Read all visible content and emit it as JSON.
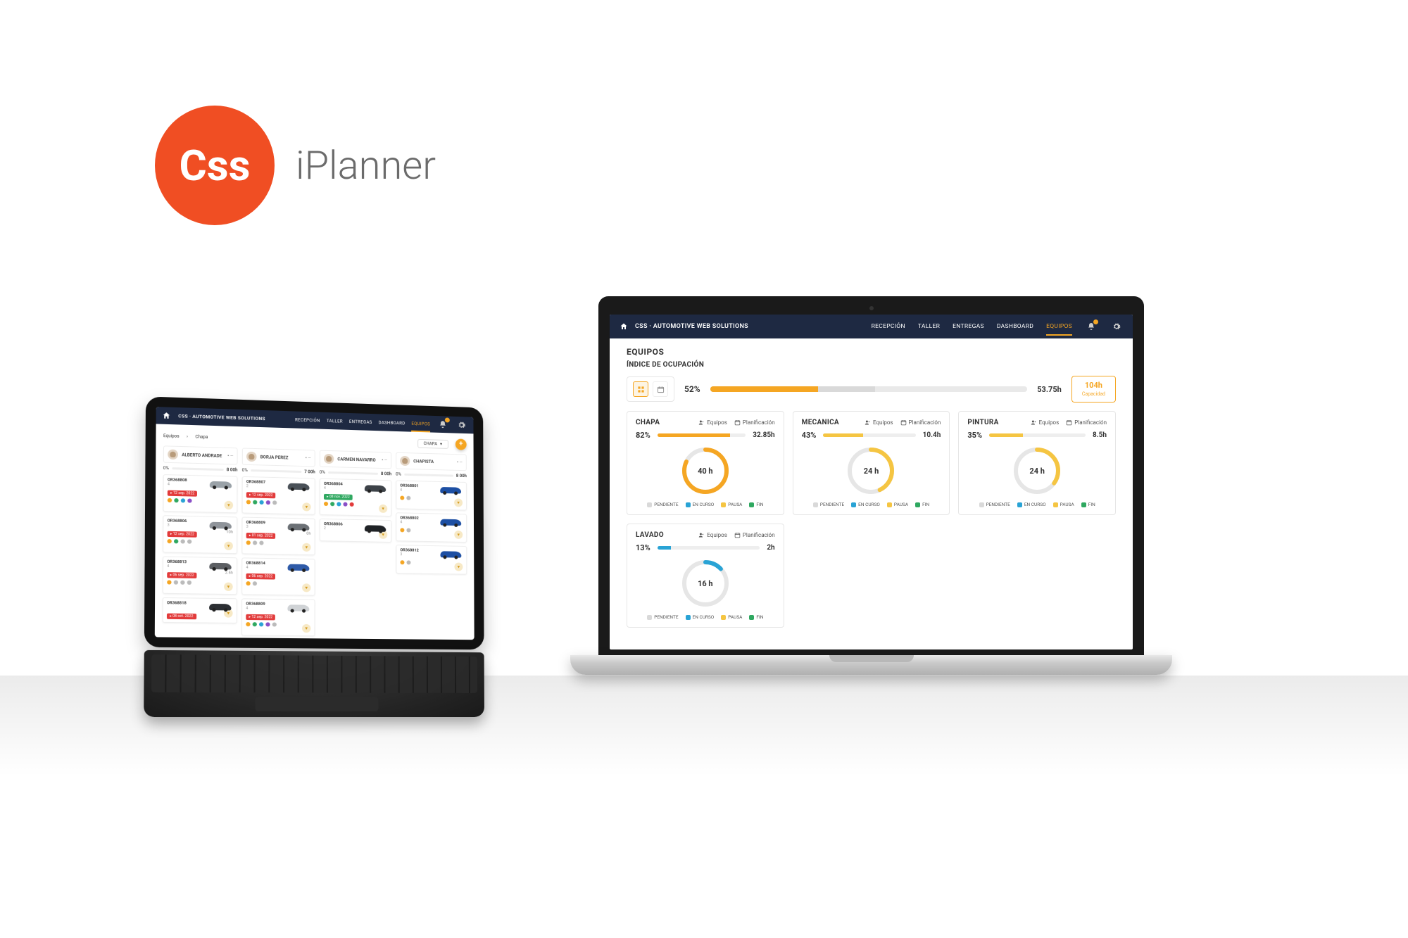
{
  "brand": {
    "circle": "Css",
    "text": "iPlanner"
  },
  "app": {
    "title": "CSS · AUTOMOTIVE WEB SOLUTIONS"
  },
  "nav": {
    "items": [
      "RECEPCIÓN",
      "TALLER",
      "ENTREGAS",
      "DASHBOARD",
      "EQUIPOS"
    ],
    "active": "EQUIPOS"
  },
  "laptop": {
    "h1": "EQUIPOS",
    "h2": "ÍNDICE DE OCUPACIÓN",
    "summary": {
      "percent": "52%",
      "hours": "53.75h",
      "capacity_value": "104h",
      "capacity_label": "Capacidad",
      "seg_orange_pct": 34,
      "seg_mid_pct": 52
    },
    "mini_links": {
      "equipos": "Equipos",
      "planificacion": "Planificación"
    },
    "legend": {
      "pendiente": "PENDIENTE",
      "encurso": "EN CURSO",
      "pausa": "PAUSA",
      "fin": "FIN"
    },
    "cards": [
      {
        "title": "CHAPA",
        "percent": "82%",
        "hours": "32.85h",
        "bar_fill": 82,
        "bar_color": "#f5a623",
        "center": "40 h",
        "arc_color": "#f5a623",
        "arc_pct": 82
      },
      {
        "title": "MECANICA",
        "percent": "43%",
        "hours": "10.4h",
        "bar_fill": 43,
        "bar_color": "#f5c542",
        "center": "24 h",
        "arc_color": "#f5c542",
        "arc_pct": 43
      },
      {
        "title": "PINTURA",
        "percent": "35%",
        "hours": "8.5h",
        "bar_fill": 35,
        "bar_color": "#f5c542",
        "center": "24 h",
        "arc_color": "#f5c542",
        "arc_pct": 35
      },
      {
        "title": "LAVADO",
        "percent": "13%",
        "hours": "2h",
        "bar_fill": 13,
        "bar_color": "#29a3d5",
        "center": "16 h",
        "arc_color": "#29a3d5",
        "arc_pct": 13
      }
    ]
  },
  "tablet": {
    "breadcrumb": [
      "Equipos",
      "Chapa"
    ],
    "dropdown": "CHAPA",
    "columns": [
      {
        "name": "ALBERTO ANDRADE",
        "pct": "0%",
        "hrs": "8 00h",
        "bar": 0,
        "jobs": [
          {
            "id": "OR368808",
            "sub": "4",
            "car": "#9aa2a8",
            "tag": "12 sep. 2022",
            "tag_cls": "tag-red",
            "dots": [
              "d-o",
              "d-g",
              "d-b",
              "d-p"
            ]
          },
          {
            "id": "OR368806",
            "sub": "3",
            "car": "#8f949a",
            "tag": "12 sep. 2022",
            "tag_cls": "tag-red",
            "dots": [
              "d-o",
              "d-g",
              "d-gr",
              "d-gr"
            ],
            "time": "10h"
          },
          {
            "id": "OR368813",
            "sub": "4",
            "car": "#5c5f63",
            "tag": "06 sep. 2022",
            "tag_cls": "tag-red",
            "dots": [
              "d-o",
              "d-gr",
              "d-gr",
              "d-gr"
            ],
            "time": "2.5h"
          },
          {
            "id": "OR368818",
            "sub": "",
            "car": "#2c2f33",
            "tag": "08 oct. 2022",
            "tag_cls": "tag-red"
          }
        ]
      },
      {
        "name": "BORJA PÉREZ",
        "pct": "0%",
        "hrs": "7 00h",
        "bar": 0,
        "jobs": [
          {
            "id": "OR368807",
            "sub": "2",
            "car": "#4a5158",
            "tag": "12 sep. 2022",
            "tag_cls": "tag-red",
            "dots": [
              "d-o",
              "d-g",
              "d-b",
              "d-p",
              "d-gr"
            ]
          },
          {
            "id": "OR368809",
            "sub": "3",
            "car": "#6b7075",
            "tag": "01 sep. 2022",
            "tag_cls": "tag-red",
            "dots": [
              "d-o",
              "d-gr",
              "d-gr"
            ],
            "time": "0h"
          },
          {
            "id": "OR368814",
            "sub": "4",
            "car": "#2e5aa8",
            "tag": "06 sep. 2022",
            "tag_cls": "tag-red",
            "dots": [
              "d-o",
              "d-gr"
            ]
          },
          {
            "id": "OR368809",
            "sub": "4",
            "car": "#d0d3d6",
            "tag": "12 sep. 2022",
            "tag_cls": "tag-red",
            "dots": [
              "d-o",
              "d-g",
              "d-b",
              "d-p",
              "d-gr"
            ]
          }
        ]
      },
      {
        "name": "CARMEN NAVARRO",
        "pct": "0%",
        "hrs": "8 00h",
        "bar": 0,
        "jobs": [
          {
            "id": "OR368804",
            "sub": "4",
            "car": "#3d4248",
            "tag": "08 nov. 2022",
            "tag_cls": "tag-green",
            "dots": [
              "d-o",
              "d-g",
              "d-b",
              "d-p",
              "d-r"
            ]
          },
          {
            "id": "OR368806",
            "sub": "2",
            "car": "#1f2226",
            "tag": "",
            "tag_cls": ""
          }
        ]
      },
      {
        "name": "CHAPISTA",
        "pct": "0%",
        "hrs": "8 00h",
        "bar": 0,
        "jobs": [
          {
            "id": "OR368801",
            "sub": "4",
            "car": "#1d4fa3",
            "tag": "",
            "tag_cls": "",
            "dots": [
              "d-o",
              "d-gr"
            ]
          },
          {
            "id": "OR368802",
            "sub": "4",
            "car": "#1d4fa3",
            "tag": "",
            "tag_cls": "",
            "dots": [
              "d-o",
              "d-gr"
            ]
          },
          {
            "id": "OR368812",
            "sub": "3",
            "car": "#1d4fa3",
            "tag": "",
            "tag_cls": "",
            "dots": [
              "d-o",
              "d-gr"
            ]
          }
        ]
      }
    ]
  }
}
